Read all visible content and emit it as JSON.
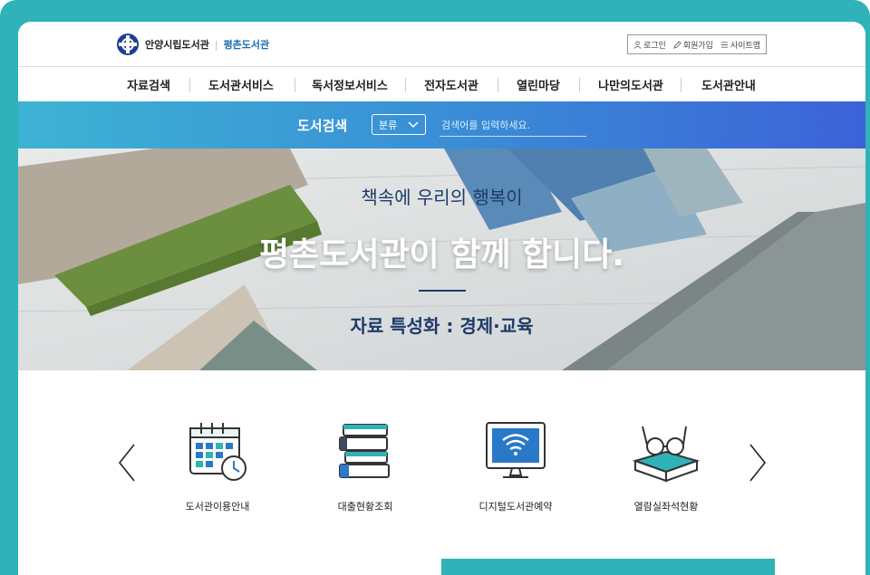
{
  "header": {
    "library_name": "안양시립도서관",
    "separator": "|",
    "branch_name": "평촌도서관",
    "util": {
      "login": "로그인",
      "join": "회원가입",
      "sitemap": "사이트맵"
    }
  },
  "nav": [
    "자료검색",
    "도서관서비스",
    "독서정보서비스",
    "전자도서관",
    "열린마당",
    "나만의도서관",
    "도서관안내"
  ],
  "search": {
    "title": "도서검색",
    "category": "분류",
    "placeholder": "검색어를 입력하세요."
  },
  "hero": {
    "subtitle": "책속에 우리의 행복이",
    "title": "평촌도서관이 함께 합니다.",
    "footer": "자료 특성화 : 경제·교육"
  },
  "quick_menu": [
    {
      "label": "도서관이용안내",
      "icon": "calendar-clock-icon"
    },
    {
      "label": "대출현황조회",
      "icon": "book-stack-icon"
    },
    {
      "label": "디지털도서관예약",
      "icon": "wifi-monitor-icon"
    },
    {
      "label": "열람실좌석현황",
      "icon": "glasses-book-icon"
    }
  ],
  "colors": {
    "frame": "#2fb3b8",
    "accent_dark": "#1e3a6a",
    "search_start": "#3db3d4",
    "search_end": "#3c62d8"
  }
}
